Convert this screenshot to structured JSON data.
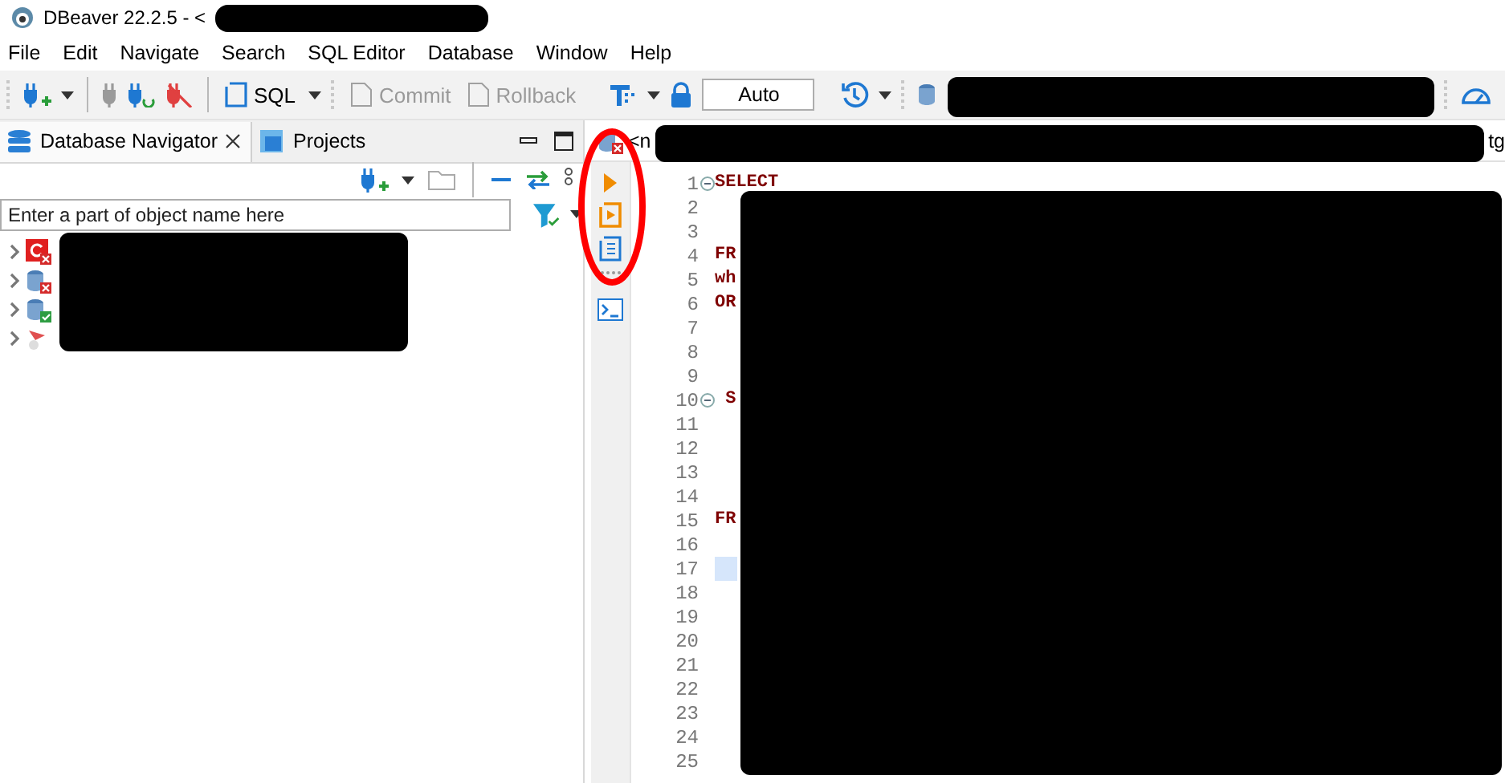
{
  "window": {
    "title": "DBeaver 22.2.5 - <"
  },
  "menu": [
    "File",
    "Edit",
    "Navigate",
    "Search",
    "SQL Editor",
    "Database",
    "Window",
    "Help"
  ],
  "toolbar": {
    "sql": {
      "label": "SQL"
    },
    "commit": {
      "label": "Commit",
      "disabled": true
    },
    "rollback": {
      "label": "Rollback",
      "disabled": true
    },
    "transaction_mode": {
      "value": "Auto"
    }
  },
  "navigator": {
    "tabs": [
      {
        "label": "Database Navigator",
        "selected": true,
        "closable": true
      },
      {
        "label": "Projects",
        "selected": false,
        "closable": false
      }
    ],
    "filter": {
      "placeholder": "Enter a part of object name here"
    },
    "tree": [
      {
        "kind": "red-error",
        "expanded": false
      },
      {
        "kind": "db-error",
        "expanded": false
      },
      {
        "kind": "db-connected",
        "expanded": false
      },
      {
        "kind": "plugin",
        "expanded": false
      }
    ]
  },
  "editor": {
    "tab": {
      "title_start": "<n",
      "title_end": "tg"
    },
    "lines": [
      {
        "number": "1",
        "code": "SELECT",
        "fold": true,
        "current": false
      },
      {
        "number": "2",
        "fold": false,
        "current": false
      },
      {
        "number": "3",
        "fold": false,
        "current": false
      },
      {
        "number": "4",
        "code": "FR",
        "fold": false,
        "current": false
      },
      {
        "number": "5",
        "code": "wh",
        "fold": false,
        "current": false
      },
      {
        "number": "6",
        "code": "OR",
        "fold": false,
        "current": false
      },
      {
        "number": "7",
        "fold": false,
        "current": false
      },
      {
        "number": "8",
        "fold": false,
        "current": false
      },
      {
        "number": "9",
        "fold": false,
        "current": false
      },
      {
        "number": "10",
        "code": " S",
        "fold": true,
        "current": false
      },
      {
        "number": "11",
        "fold": false,
        "current": false
      },
      {
        "number": "12",
        "fold": false,
        "current": false
      },
      {
        "number": "13",
        "fold": false,
        "current": false
      },
      {
        "number": "14",
        "fold": false,
        "current": false
      },
      {
        "number": "15",
        "code": "FR",
        "fold": false,
        "current": false
      },
      {
        "number": "16",
        "fold": false,
        "current": false
      },
      {
        "number": "17",
        "fold": false,
        "current": true
      },
      {
        "number": "18",
        "fold": false,
        "current": false
      },
      {
        "number": "19",
        "fold": false,
        "current": false
      },
      {
        "number": "20",
        "fold": false,
        "current": false
      },
      {
        "number": "21",
        "fold": false,
        "current": false
      },
      {
        "number": "22",
        "fold": false,
        "current": false
      },
      {
        "number": "23",
        "fold": false,
        "current": false
      },
      {
        "number": "24",
        "fold": false,
        "current": false
      },
      {
        "number": "25",
        "fold": false,
        "current": false
      }
    ]
  }
}
